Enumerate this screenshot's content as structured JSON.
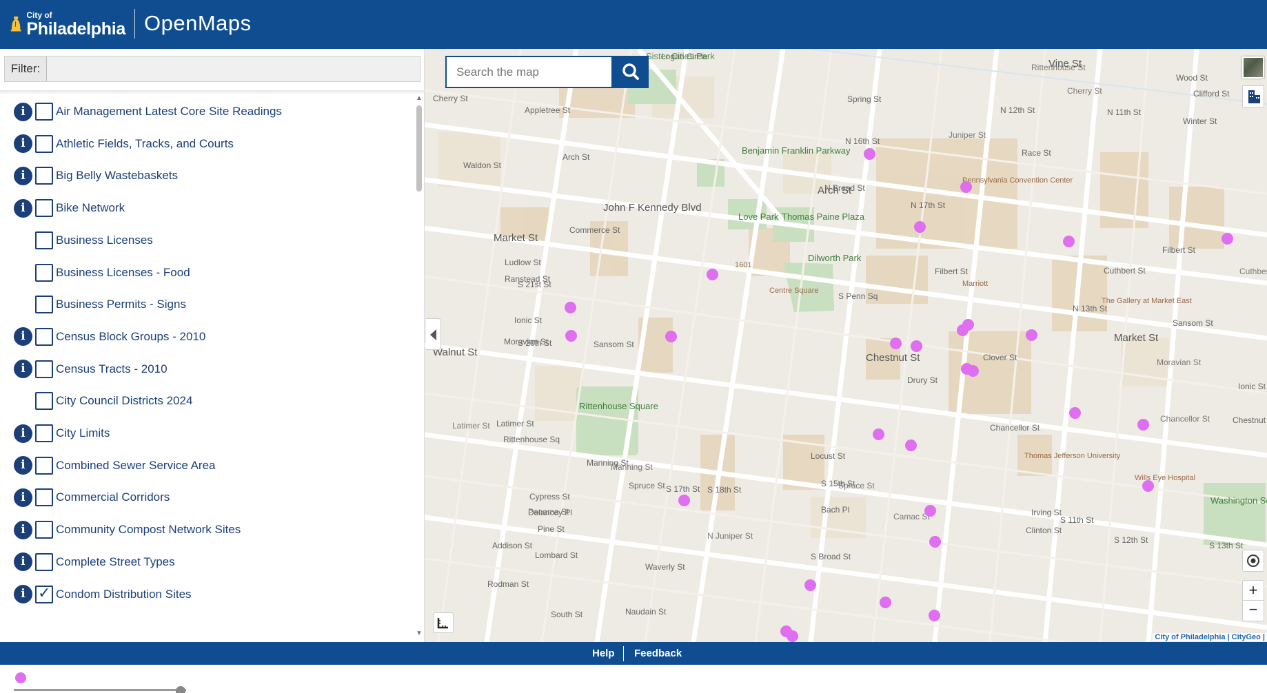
{
  "header": {
    "logo_small": "City of",
    "logo_big": "Philadelphia",
    "app_title": "OpenMaps"
  },
  "sidebar": {
    "filter_label": "Filter:",
    "filter_value": "",
    "layers": [
      {
        "label": "Air Management Latest Core Site Readings",
        "info": true,
        "checked": false
      },
      {
        "label": "Athletic Fields, Tracks, and Courts",
        "info": true,
        "checked": false
      },
      {
        "label": "Big Belly Wastebaskets",
        "info": true,
        "checked": false
      },
      {
        "label": "Bike Network",
        "info": true,
        "checked": false
      },
      {
        "label": "Business Licenses",
        "info": false,
        "checked": false
      },
      {
        "label": "Business Licenses - Food",
        "info": false,
        "checked": false
      },
      {
        "label": "Business Permits - Signs",
        "info": false,
        "checked": false
      },
      {
        "label": "Census Block Groups - 2010",
        "info": true,
        "checked": false
      },
      {
        "label": "Census Tracts - 2010",
        "info": true,
        "checked": false
      },
      {
        "label": "City Council Districts 2024",
        "info": false,
        "checked": false
      },
      {
        "label": "City Limits",
        "info": true,
        "checked": false
      },
      {
        "label": "Combined Sewer Service Area",
        "info": true,
        "checked": false
      },
      {
        "label": "Commercial Corridors",
        "info": true,
        "checked": false
      },
      {
        "label": "Community Compost Network Sites",
        "info": true,
        "checked": false
      },
      {
        "label": "Complete Street Types",
        "info": true,
        "checked": false
      },
      {
        "label": "Condom Distribution Sites",
        "info": true,
        "checked": true
      }
    ],
    "legend_color": "#df6ef0"
  },
  "map": {
    "search_placeholder": "Search the map",
    "attribution": "City of Philadelphia | CityGeo |",
    "marker_color": "#df6ef0",
    "labels": [
      "Logan Circle",
      "Sister Cities Park",
      "Vine St",
      "Cherry St",
      "Appletree St",
      "Arch St",
      "Race St",
      "Spring St",
      "Benjamin Franklin Parkway",
      "Pennsylvania Convention Center",
      "John F Kennedy Blvd",
      "Arch St",
      "Market St",
      "Love Park",
      "Thomas Paine Plaza",
      "Dilworth Park",
      "Filbert St",
      "Centre Square",
      "Marriott",
      "The Gallery at Market East",
      "Market St",
      "Ludlow St",
      "Ranstead St",
      "Ionic St",
      "Moravian St",
      "Sansom St",
      "Walnut St",
      "Chestnut St",
      "Drury St",
      "Clover St",
      "Chancellor St",
      "Rittenhouse Square",
      "Latimer St",
      "Rittenhouse Sq",
      "Manning St",
      "Spruce St",
      "Locust St",
      "Thomas Jefferson University",
      "Wills Eye Hospital",
      "Washington Square",
      "Cypress St",
      "Delancey Pl",
      "Pine St",
      "Panama St",
      "Lombard St",
      "Waverly St",
      "South St",
      "Naudain St",
      "Addison St",
      "Rodman St",
      "S Broad St",
      "N Broad St",
      "S Penn Sq",
      "S 15th St",
      "N 16th St",
      "N 17th St",
      "S 18th St",
      "S 17th St",
      "S 21st St",
      "S 20th St",
      "S 13th St",
      "S 12th St",
      "N 12th St",
      "N 11th St",
      "S 11th St",
      "N 13th St",
      "Commerce St",
      "Cuthbert St",
      "Waldon St",
      "Sansom St",
      "Bach Pl",
      "Irving St",
      "Clinton St",
      "Chestnut St",
      "Ionic St",
      "Winter St",
      "Wood St",
      "Clifford St",
      "1601",
      "Cherry St",
      "Filbert St",
      "Cuthbert St",
      "Chancellor St",
      "Moravian St",
      "Manning St",
      "Spruce St",
      "Latimer St",
      "Rittenhouse St",
      "Camac St",
      "Juniper St",
      "N Juniper St",
      "Cypress St"
    ]
  },
  "footer": {
    "help": "Help",
    "feedback": "Feedback"
  }
}
